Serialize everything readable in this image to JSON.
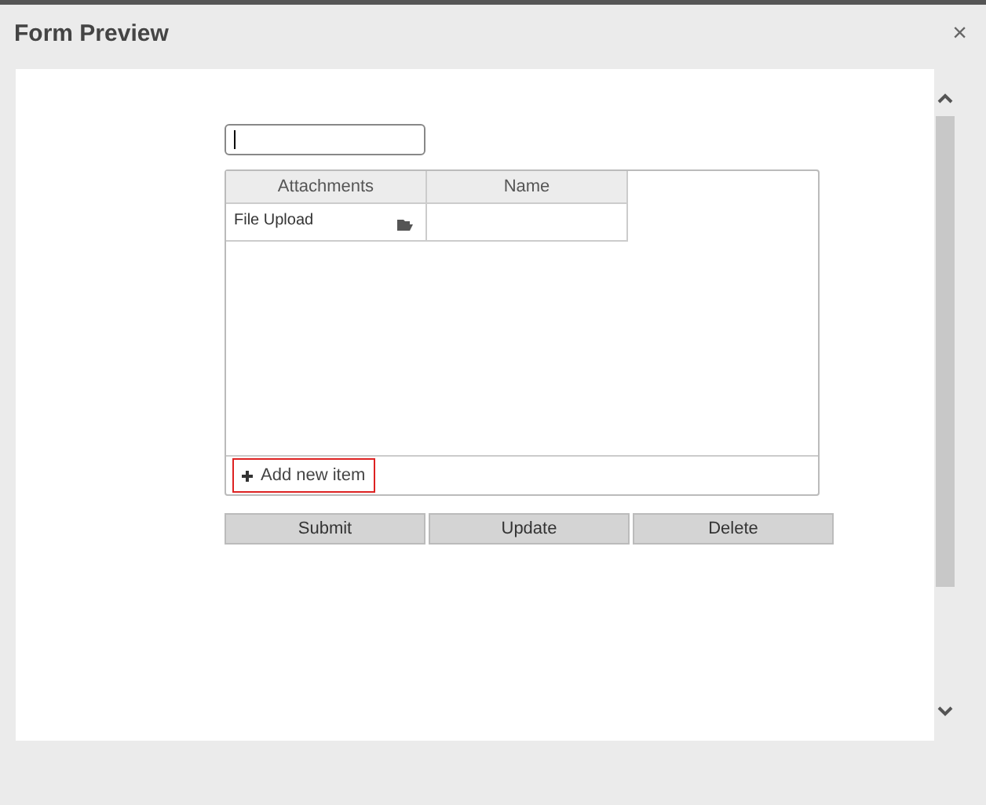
{
  "dialog": {
    "title": "Form Preview",
    "close": "×"
  },
  "table": {
    "columns": [
      "Attachments",
      "Name"
    ],
    "rows": [
      {
        "attachments": "File Upload"
      }
    ],
    "add_button": "Add new item"
  },
  "buttons": [
    "Submit",
    "Update",
    "Delete"
  ]
}
